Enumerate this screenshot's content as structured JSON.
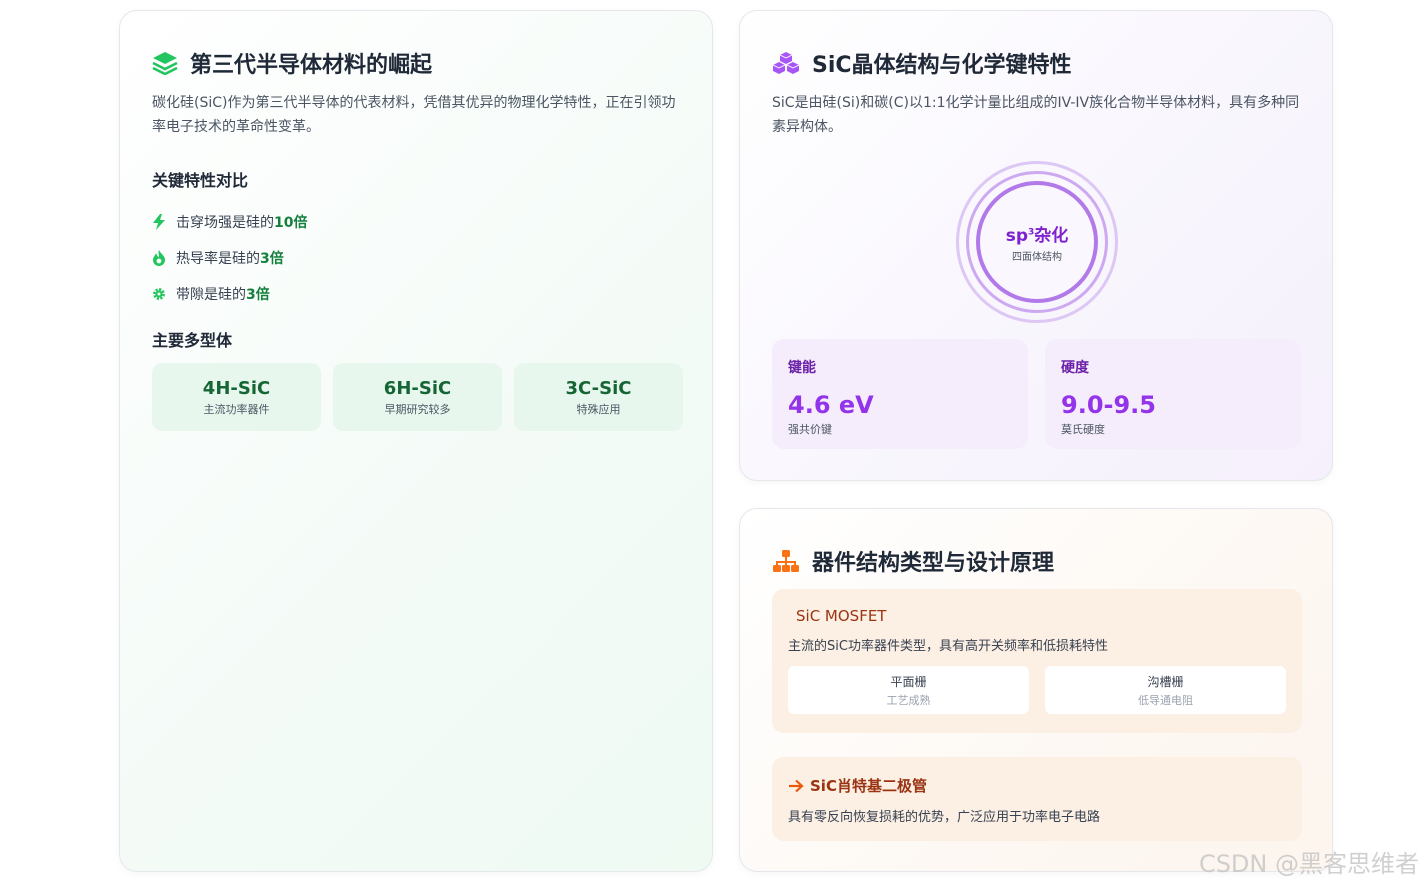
{
  "left_card": {
    "title": "第三代半导体材料的崛起",
    "description": "碳化硅(SiC)作为第三代半导体的代表材料，凭借其优异的物理化学特性，正在引领功率电子技术的革命性变革。",
    "features_title": "关键特性对比",
    "features": [
      {
        "icon": "lightning-icon",
        "text": "击穿场强是硅的",
        "highlight": "10倍"
      },
      {
        "icon": "flame-icon",
        "text": "热导率是硅的",
        "highlight": "3倍"
      },
      {
        "icon": "gear-icon",
        "text": "带隙是硅的",
        "highlight": "3倍"
      }
    ],
    "polytypes_title": "主要多型体",
    "polytypes": [
      {
        "name": "4H-SiC",
        "desc": "主流功率器件"
      },
      {
        "name": "6H-SiC",
        "desc": "早期研究较多"
      },
      {
        "name": "3C-SiC",
        "desc": "特殊应用"
      }
    ]
  },
  "crystal_card": {
    "title": "SiC晶体结构与化学键特性",
    "description": "SiC是由硅(Si)和碳(C)以1:1化学计量比组成的IV-IV族化合物半导体材料，具有多种同素异构体。",
    "orbit_main_prefix": "sp",
    "orbit_main_sup": "3",
    "orbit_main_suffix": "杂化",
    "orbit_sub": "四面体结构",
    "stats": [
      {
        "label": "键能",
        "value": "4.6 eV",
        "sub": "强共价键"
      },
      {
        "label": "硬度",
        "value": "9.0-9.5",
        "sub": "莫氏硬度"
      }
    ]
  },
  "device_card": {
    "title": "器件结构类型与设计原理",
    "mosfet": {
      "title": "SiC MOSFET",
      "desc": "主流的SiC功率器件类型，具有高开关频率和低损耗特性",
      "gates": [
        {
          "name": "平面栅",
          "desc": "工艺成熟"
        },
        {
          "name": "沟槽栅",
          "desc": "低导通电阻"
        }
      ]
    },
    "sbd": {
      "title": "SiC肖特基二极管",
      "desc": "具有零反向恢复损耗的优势，广泛应用于功率电子电路"
    }
  },
  "watermark": "CSDN @黑客思维者",
  "colors": {
    "green_accent": "#15803d",
    "purple_accent": "#9333ea",
    "orange_accent": "#ea580c"
  }
}
